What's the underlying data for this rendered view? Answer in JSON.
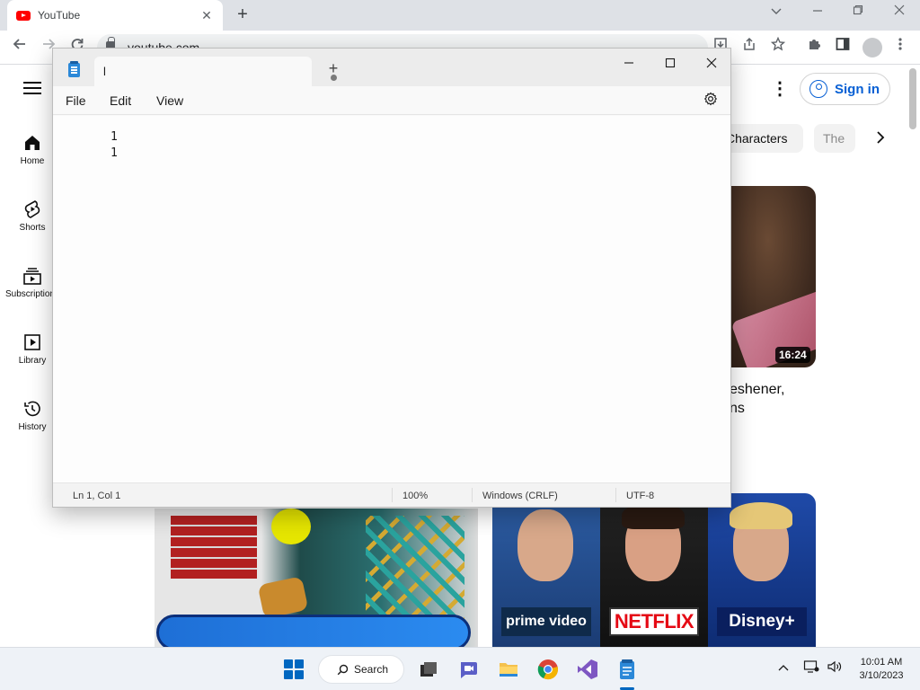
{
  "browser": {
    "tab_title": "YouTube",
    "new_tab": "+",
    "address": "youtube.com",
    "window_controls": [
      "chevron-down-icon",
      "minimize-icon",
      "restore-icon",
      "close-icon"
    ]
  },
  "youtube": {
    "sidebar": [
      {
        "label": "Home",
        "icon": "home-icon"
      },
      {
        "label": "Shorts",
        "icon": "shorts-icon"
      },
      {
        "label": "Subscriptions",
        "icon": "subscriptions-icon"
      },
      {
        "label": "Library",
        "icon": "library-icon"
      },
      {
        "label": "History",
        "icon": "history-icon"
      }
    ],
    "signin_label": "Sign in",
    "chips": [
      "Characters",
      "The"
    ],
    "videos": [
      {
        "duration": "16:24",
        "title_line1": "eshener,",
        "title_line2": "ns"
      }
    ],
    "thumb_logos": [
      "prime video",
      "NETFLIX",
      "Disney+"
    ]
  },
  "notepad": {
    "tab_title": "l",
    "menu": [
      "File",
      "Edit",
      "View"
    ],
    "content_lines": [
      "1",
      "1"
    ],
    "status": {
      "position": "Ln 1, Col 1",
      "zoom": "100%",
      "line_endings": "Windows (CRLF)",
      "encoding": "UTF-8"
    }
  },
  "taskbar": {
    "search_label": "Search",
    "time": "10:01 AM",
    "date": "3/10/2023",
    "colors": {
      "accent": "#0067c0"
    }
  }
}
